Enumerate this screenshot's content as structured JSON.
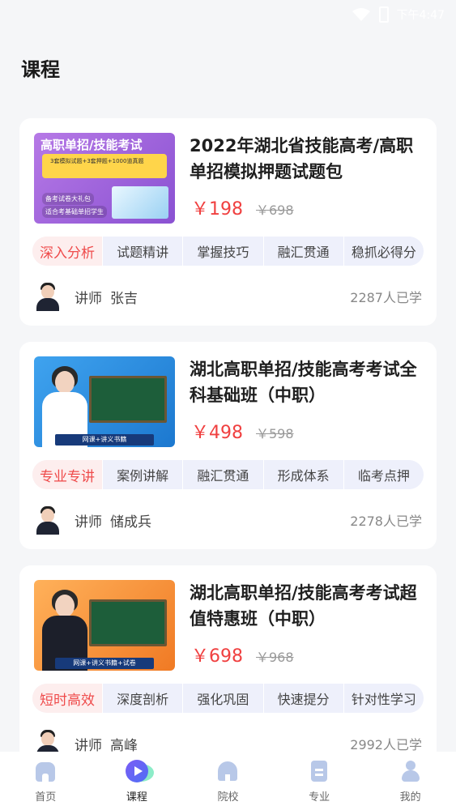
{
  "status_bar": {
    "time": "下午4:47"
  },
  "page": {
    "title": "课程"
  },
  "courses": [
    {
      "thumb_title": "高职单招/技能考试",
      "thumb_band": "3套模拟试题+3套押题+1000道真题",
      "thumb_check_1": "备考试卷大礼包",
      "thumb_check_2": "适合考基础单招学生",
      "title": "2022年湖北省技能高考/高职单招模拟押题试题包",
      "price": "￥198",
      "orig_price": "￥698",
      "tag_main": "深入分析",
      "tags": [
        "试题精讲",
        "掌握技巧",
        "融汇贯通",
        "稳抓必得分"
      ],
      "teacher_label": "讲师",
      "teacher_name": "张吉",
      "learners": "2287人已学"
    },
    {
      "thumb_footer": "网课+讲义书籍",
      "title": "湖北高职单招/技能高考考试全科基础班（中职）",
      "price": "￥498",
      "orig_price": "￥598",
      "tag_main": "专业专讲",
      "tags": [
        "案例讲解",
        "融汇贯通",
        "形成体系",
        "临考点押"
      ],
      "teacher_label": "讲师",
      "teacher_name": "储成兵",
      "learners": "2278人已学"
    },
    {
      "thumb_footer": "网课+讲义书籍+试卷",
      "title": "湖北高职单招/技能高考考试超值特惠班（中职）",
      "price": "￥698",
      "orig_price": "￥968",
      "tag_main": "短时高效",
      "tags": [
        "深度剖析",
        "强化巩固",
        "快速提分",
        "针对性学习"
      ],
      "teacher_label": "讲师",
      "teacher_name": "高峰",
      "learners": "2992人已学"
    }
  ],
  "nav": [
    {
      "label": "首页",
      "icon": "home-icon"
    },
    {
      "label": "课程",
      "icon": "course-icon",
      "active": true
    },
    {
      "label": "院校",
      "icon": "school-icon"
    },
    {
      "label": "专业",
      "icon": "major-icon"
    },
    {
      "label": "我的",
      "icon": "profile-icon"
    }
  ],
  "colors": {
    "price": "#f04040",
    "tag_main": "#ef4b4b",
    "accent": "#6c5cf5"
  }
}
